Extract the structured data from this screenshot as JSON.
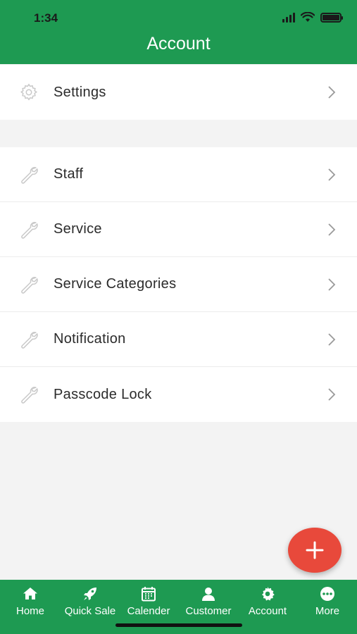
{
  "status_bar": {
    "time": "1:34"
  },
  "header": {
    "title": "Account"
  },
  "menu_groups": [
    [
      {
        "label": "Settings",
        "icon": "gear-icon"
      }
    ],
    [
      {
        "label": "Staff",
        "icon": "wrench-icon"
      },
      {
        "label": "Service",
        "icon": "wrench-icon"
      },
      {
        "label": "Service Categories",
        "icon": "wrench-icon"
      },
      {
        "label": "Notification",
        "icon": "wrench-icon"
      },
      {
        "label": "Passcode Lock",
        "icon": "wrench-icon"
      }
    ]
  ],
  "fab": {
    "icon": "plus-icon"
  },
  "tabbar": {
    "tabs": [
      {
        "label": "Home",
        "icon": "home-icon"
      },
      {
        "label": "Quick Sale",
        "icon": "rocket-icon"
      },
      {
        "label": "Calender",
        "icon": "calendar-icon"
      },
      {
        "label": "Customer",
        "icon": "person-icon"
      },
      {
        "label": "Account",
        "icon": "gear-icon",
        "active": true
      },
      {
        "label": "More",
        "icon": "more-icon"
      }
    ]
  },
  "colors": {
    "primary_green": "#1e9a52",
    "fab_red": "#e8493b",
    "background": "#f3f3f3",
    "icon_gray": "#c9c9c9"
  }
}
